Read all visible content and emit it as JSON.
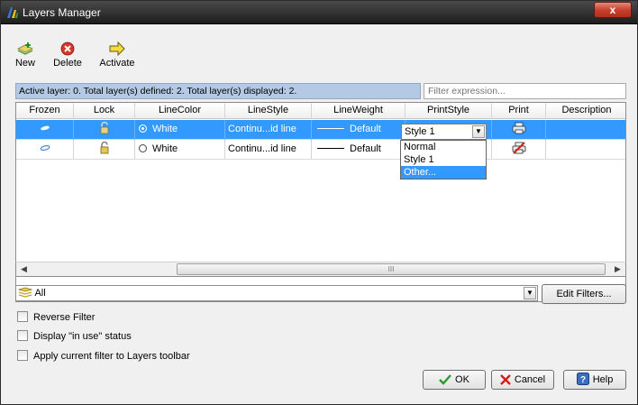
{
  "window": {
    "title": "Layers Manager",
    "close_label": "x"
  },
  "toolbar": {
    "new_label": "New",
    "delete_label": "Delete",
    "activate_label": "Activate"
  },
  "status": {
    "text": "Active layer: 0. Total layer(s) defined: 2. Total layer(s) displayed: 2."
  },
  "filter_expression": {
    "placeholder": "Filter expression..."
  },
  "grid": {
    "columns": [
      "Frozen",
      "Lock",
      "LineColor",
      "LineStyle",
      "LineWeight",
      "PrintStyle",
      "Print",
      "Description"
    ],
    "rows": [
      {
        "color": "White",
        "linestyle": "Continu...id line",
        "lineweight": "Default",
        "printstyle": "Style 1",
        "selected": true
      },
      {
        "color": "White",
        "linestyle": "Continu...id line",
        "lineweight": "Default",
        "printstyle": "",
        "selected": false
      }
    ]
  },
  "printstyle_dropdown": {
    "selected": "Style 1",
    "options": [
      "Normal",
      "Style 1",
      "Other..."
    ],
    "highlighted": "Other..."
  },
  "scroll_thumb": "III",
  "filter": {
    "value": "All",
    "edit_label": "Edit Filters..."
  },
  "options": {
    "reverse_filter": "Reverse Filter",
    "display_in_use": "Display \"in use\" status",
    "apply_filter_toolbar": "Apply current filter to Layers toolbar"
  },
  "buttons": {
    "ok": "OK",
    "cancel": "Cancel",
    "help": "Help"
  },
  "colors": {
    "selection": "#3399ff",
    "status_bg": "#b4cae4",
    "title_bg": "#1d1d1d"
  }
}
